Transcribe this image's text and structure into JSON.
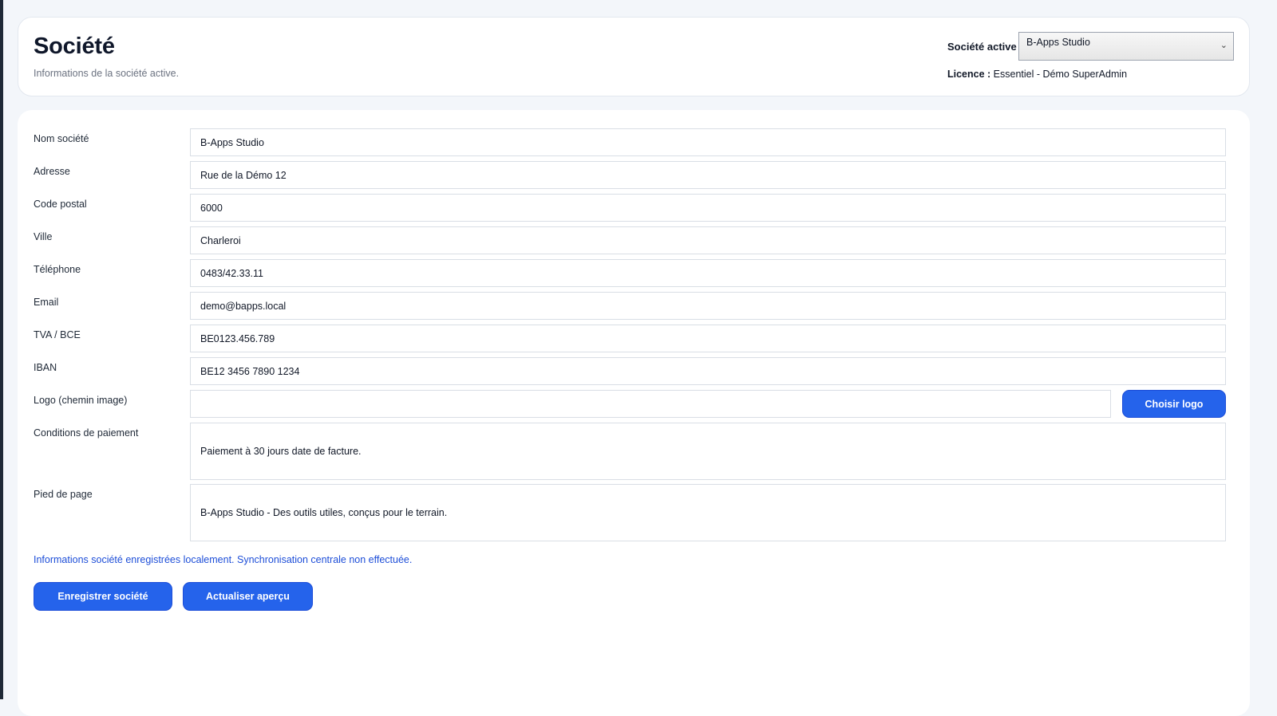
{
  "header": {
    "title": "Société",
    "subtitle": "Informations de la société active.",
    "active_company_label": "Société active",
    "active_company_value": "B-Apps Studio",
    "licence_label": "Licence :",
    "licence_value": "Essentiel - Démo SuperAdmin"
  },
  "form": {
    "fields": [
      {
        "label": "Nom société",
        "value": "B-Apps Studio"
      },
      {
        "label": "Adresse",
        "value": "Rue de la Démo 12"
      },
      {
        "label": "Code postal",
        "value": "6000"
      },
      {
        "label": "Ville",
        "value": "Charleroi"
      },
      {
        "label": "Téléphone",
        "value": "0483/42.33.11"
      },
      {
        "label": "Email",
        "value": "demo@bapps.local"
      },
      {
        "label": "TVA / BCE",
        "value": "BE0123.456.789"
      },
      {
        "label": "IBAN",
        "value": "BE12 3456 7890 1234"
      },
      {
        "label": "Logo (chemin image)",
        "value": ""
      },
      {
        "label": "Conditions de paiement",
        "value": "Paiement à 30 jours date de facture."
      },
      {
        "label": "Pied de page",
        "value": "B-Apps Studio - Des outils utiles, conçus pour le terrain."
      }
    ],
    "choose_logo_label": "Choisir logo",
    "status_message": "Informations société enregistrées localement. Synchronisation centrale non effectuée.",
    "save_label": "Enregistrer société",
    "refresh_label": "Actualiser aperçu"
  },
  "colors": {
    "accent": "#2563eb",
    "status_text": "#1d4ed8",
    "background": "#f3f6fa"
  }
}
